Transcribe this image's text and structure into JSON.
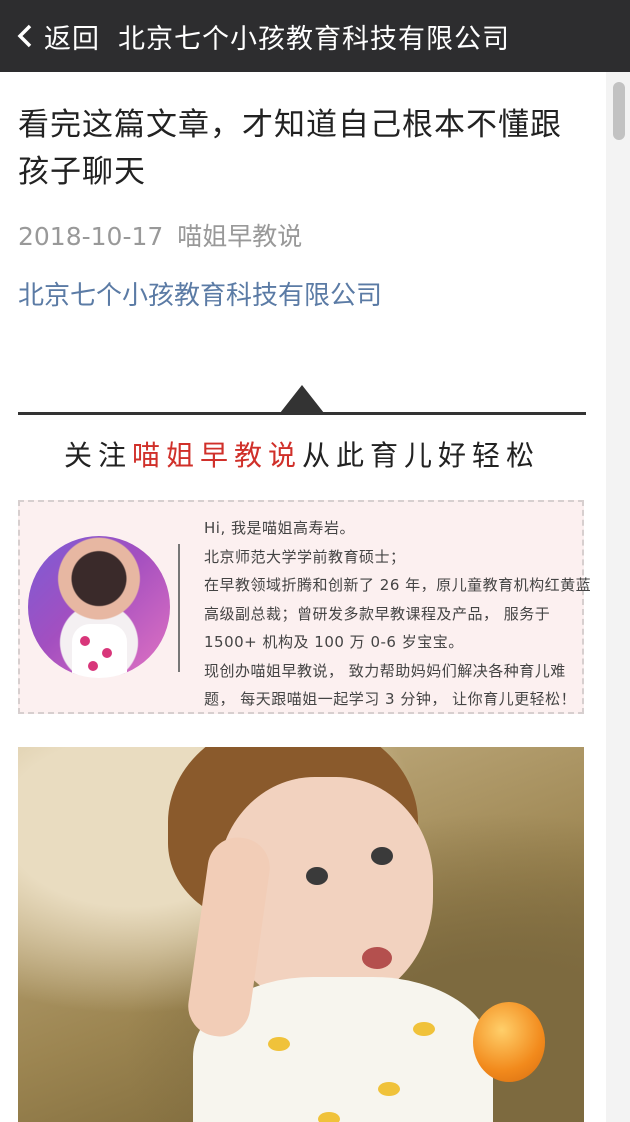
{
  "topbar": {
    "back_label": "返回",
    "title": "北京七个小孩教育科技有限公司"
  },
  "article": {
    "title": "看完这篇文章，才知道自己根本不懂跟孩子聊天",
    "date": "2018-10-17",
    "author": "喵姐早教说",
    "account_link": "北京七个小孩教育科技有限公司"
  },
  "banner": {
    "follow_prefix": "关注",
    "follow_name": "喵姐早教说",
    "follow_suffix": "从此育儿好轻松",
    "intro_lines": [
      "Hi,  我是喵姐高寿岩。",
      "北京师范大学学前教育硕士；",
      "在早教领域折腾和创新了 26 年，原儿童教育机构红黄蓝",
      "高级副总裁；曾研发多款早教课程及产品， 服务于",
      "1500+ 机构及 100 万 0-6 岁宝宝。",
      "现创办喵姐早教说， 致力帮助妈妈们解决各种育儿难",
      "题， 每天跟喵姐一起学习 3 分钟， 让你育儿更轻松！"
    ]
  },
  "colors": {
    "topbar": "#2d2d2f",
    "link": "#5b7ba5",
    "accent_red": "#d0302a",
    "card_bg": "#fcf0f0"
  }
}
